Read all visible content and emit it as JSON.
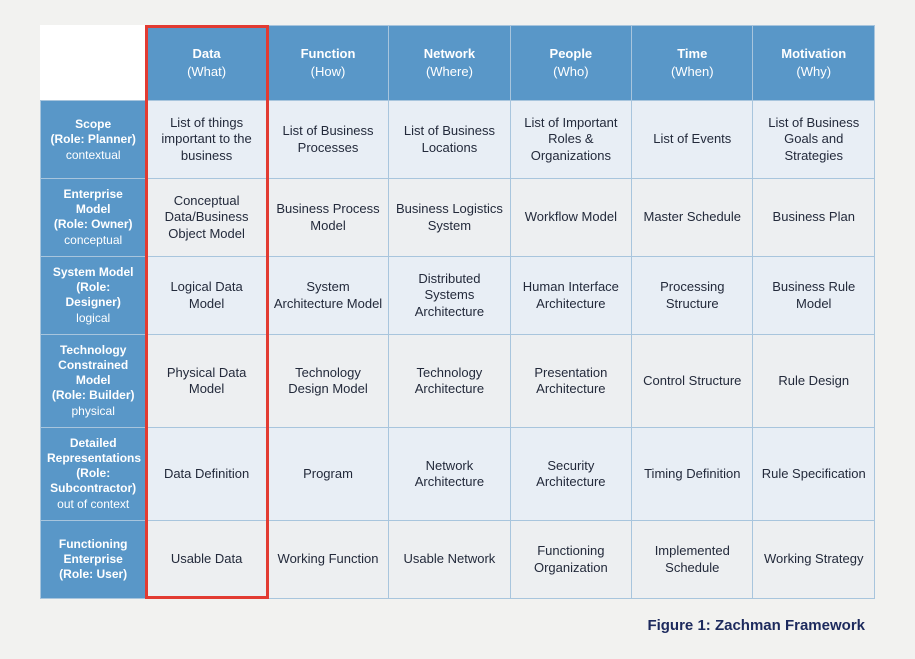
{
  "columns": [
    {
      "title": "Data",
      "sub": "(What)"
    },
    {
      "title": "Function",
      "sub": "(How)"
    },
    {
      "title": "Network",
      "sub": "(Where)"
    },
    {
      "title": "People",
      "sub": "(Who)"
    },
    {
      "title": "Time",
      "sub": "(When)"
    },
    {
      "title": "Motivation",
      "sub": "(Why)"
    }
  ],
  "rows": [
    {
      "title": "Scope",
      "role": "(Role: Planner)",
      "perspective": "contextual",
      "cells": [
        "List of things important to the business",
        "List of Business Processes",
        "List of Business Locations",
        "List of Important Roles & Organizations",
        "List of Events",
        "List of Business Goals and Strategies"
      ]
    },
    {
      "title": "Enterprise Model",
      "role": "(Role: Owner)",
      "perspective": "conceptual",
      "cells": [
        "Conceptual Data/Business Object Model",
        "Business Process Model",
        "Business Logistics System",
        "Workflow Model",
        "Master Schedule",
        "Business Plan"
      ]
    },
    {
      "title": "System Model",
      "role": "(Role: Designer)",
      "perspective": "logical",
      "cells": [
        "Logical Data Model",
        "System Architecture Model",
        "Distributed Systems Architecture",
        "Human Interface Architecture",
        "Processing Structure",
        "Business Rule Model"
      ]
    },
    {
      "title": "Technology Constrained Model",
      "role": "(Role: Builder)",
      "perspective": "physical",
      "cells": [
        "Physical Data Model",
        "Technology Design Model",
        "Technology Architecture",
        "Presentation Architecture",
        "Control Structure",
        "Rule Design"
      ]
    },
    {
      "title": "Detailed Representations",
      "role": "(Role: Subcontractor)",
      "perspective": "out of context",
      "cells": [
        "Data Definition",
        "Program",
        "Network Architecture",
        "Security Architecture",
        "Timing Definition",
        "Rule Specification"
      ]
    },
    {
      "title": "Functioning Enterprise",
      "role": "(Role: User)",
      "perspective": "",
      "cells": [
        "Usable Data",
        "Working Function",
        "Usable Network",
        "Functioning Organization",
        "Implemented Schedule",
        "Working Strategy"
      ]
    }
  ],
  "caption": "Figure 1: Zachman Framework",
  "highlighted_column_index": 0
}
